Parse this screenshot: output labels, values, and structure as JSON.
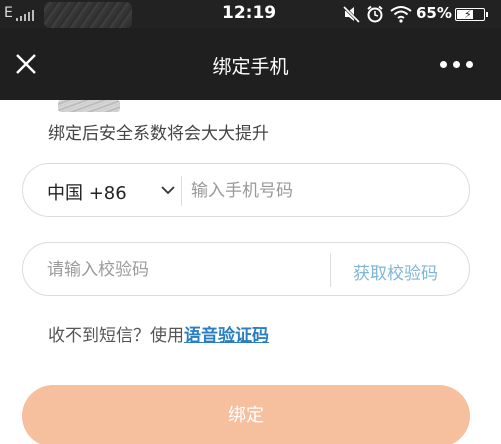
{
  "status_bar": {
    "carrier": "E",
    "time": "12:19",
    "battery_text": "65%",
    "battery_level": 0.65,
    "icons": [
      "mute-icon",
      "alarm-icon",
      "wifi-icon",
      "battery-icon"
    ]
  },
  "nav": {
    "title": "绑定手机",
    "close_icon": "close-icon",
    "more_icon": "more-icon"
  },
  "content": {
    "subtitle": "绑定后安全系数将会大大提升",
    "country_code": "中国 +86",
    "phone_placeholder": "输入手机号码",
    "code_placeholder": "请输入校验码",
    "get_code_label": "获取校验码",
    "help_text": "收不到短信？使用",
    "help_link": "语音验证码",
    "bind_label": "绑定"
  },
  "colors": {
    "nav_bg": "#1f1f1f",
    "button_bg": "#f6bf9d",
    "link": "#2a7fc2",
    "get_code": "#7fb6d6"
  }
}
